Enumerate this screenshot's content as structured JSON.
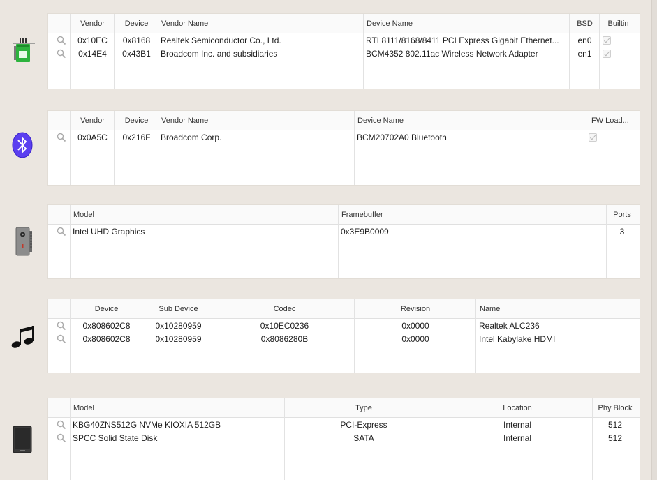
{
  "network": {
    "headers": [
      "Vendor",
      "Device",
      "Vendor Name",
      "Device Name",
      "BSD",
      "Builtin"
    ],
    "rows": [
      {
        "vendor": "0x10EC",
        "device": "0x8168",
        "vendor_name": "Realtek Semiconductor Co., Ltd.",
        "device_name": "RTL8111/8168/8411 PCI Express Gigabit Ethernet...",
        "bsd": "en0",
        "builtin": true
      },
      {
        "vendor": "0x14E4",
        "device": "0x43B1",
        "vendor_name": "Broadcom Inc. and subsidiaries",
        "device_name": "BCM4352 802.11ac Wireless Network Adapter",
        "bsd": "en1",
        "builtin": true
      }
    ]
  },
  "bluetooth": {
    "headers": [
      "Vendor",
      "Device",
      "Vendor Name",
      "Device Name",
      "FW Load..."
    ],
    "rows": [
      {
        "vendor": "0x0A5C",
        "device": "0x216F",
        "vendor_name": "Broadcom Corp.",
        "device_name": "BCM20702A0 Bluetooth",
        "fw_load": true
      }
    ]
  },
  "graphics": {
    "headers": [
      "Model",
      "Framebuffer",
      "Ports"
    ],
    "rows": [
      {
        "model": "Intel UHD Graphics",
        "framebuffer": "0x3E9B0009",
        "ports": "3"
      }
    ]
  },
  "audio": {
    "headers": [
      "Device",
      "Sub Device",
      "Codec",
      "Revision",
      "Name"
    ],
    "rows": [
      {
        "device": "0x808602C8",
        "sub_device": "0x10280959",
        "codec": "0x10EC0236",
        "revision": "0x0000",
        "name": "Realtek ALC236"
      },
      {
        "device": "0x808602C8",
        "sub_device": "0x10280959",
        "codec": "0x8086280B",
        "revision": "0x0000",
        "name": "Intel Kabylake HDMI"
      }
    ]
  },
  "storage": {
    "headers": [
      "Model",
      "Type",
      "Location",
      "Phy Block"
    ],
    "rows": [
      {
        "model": "KBG40ZNS512G NVMe KIOXIA 512GB",
        "type": "PCI-Express",
        "location": "Internal",
        "phy_block": "512"
      },
      {
        "model": "SPCC Solid State Disk",
        "type": "SATA",
        "location": "Internal",
        "phy_block": "512"
      }
    ]
  },
  "icons": {
    "network": "network-card-icon",
    "bluetooth": "bluetooth-icon",
    "graphics": "graphics-card-icon",
    "audio": "music-note-icon",
    "storage": "disk-drive-icon",
    "row": "magnifier-icon"
  },
  "colors": {
    "bluetooth": "#5b3ff0",
    "network": "#2db33e"
  }
}
